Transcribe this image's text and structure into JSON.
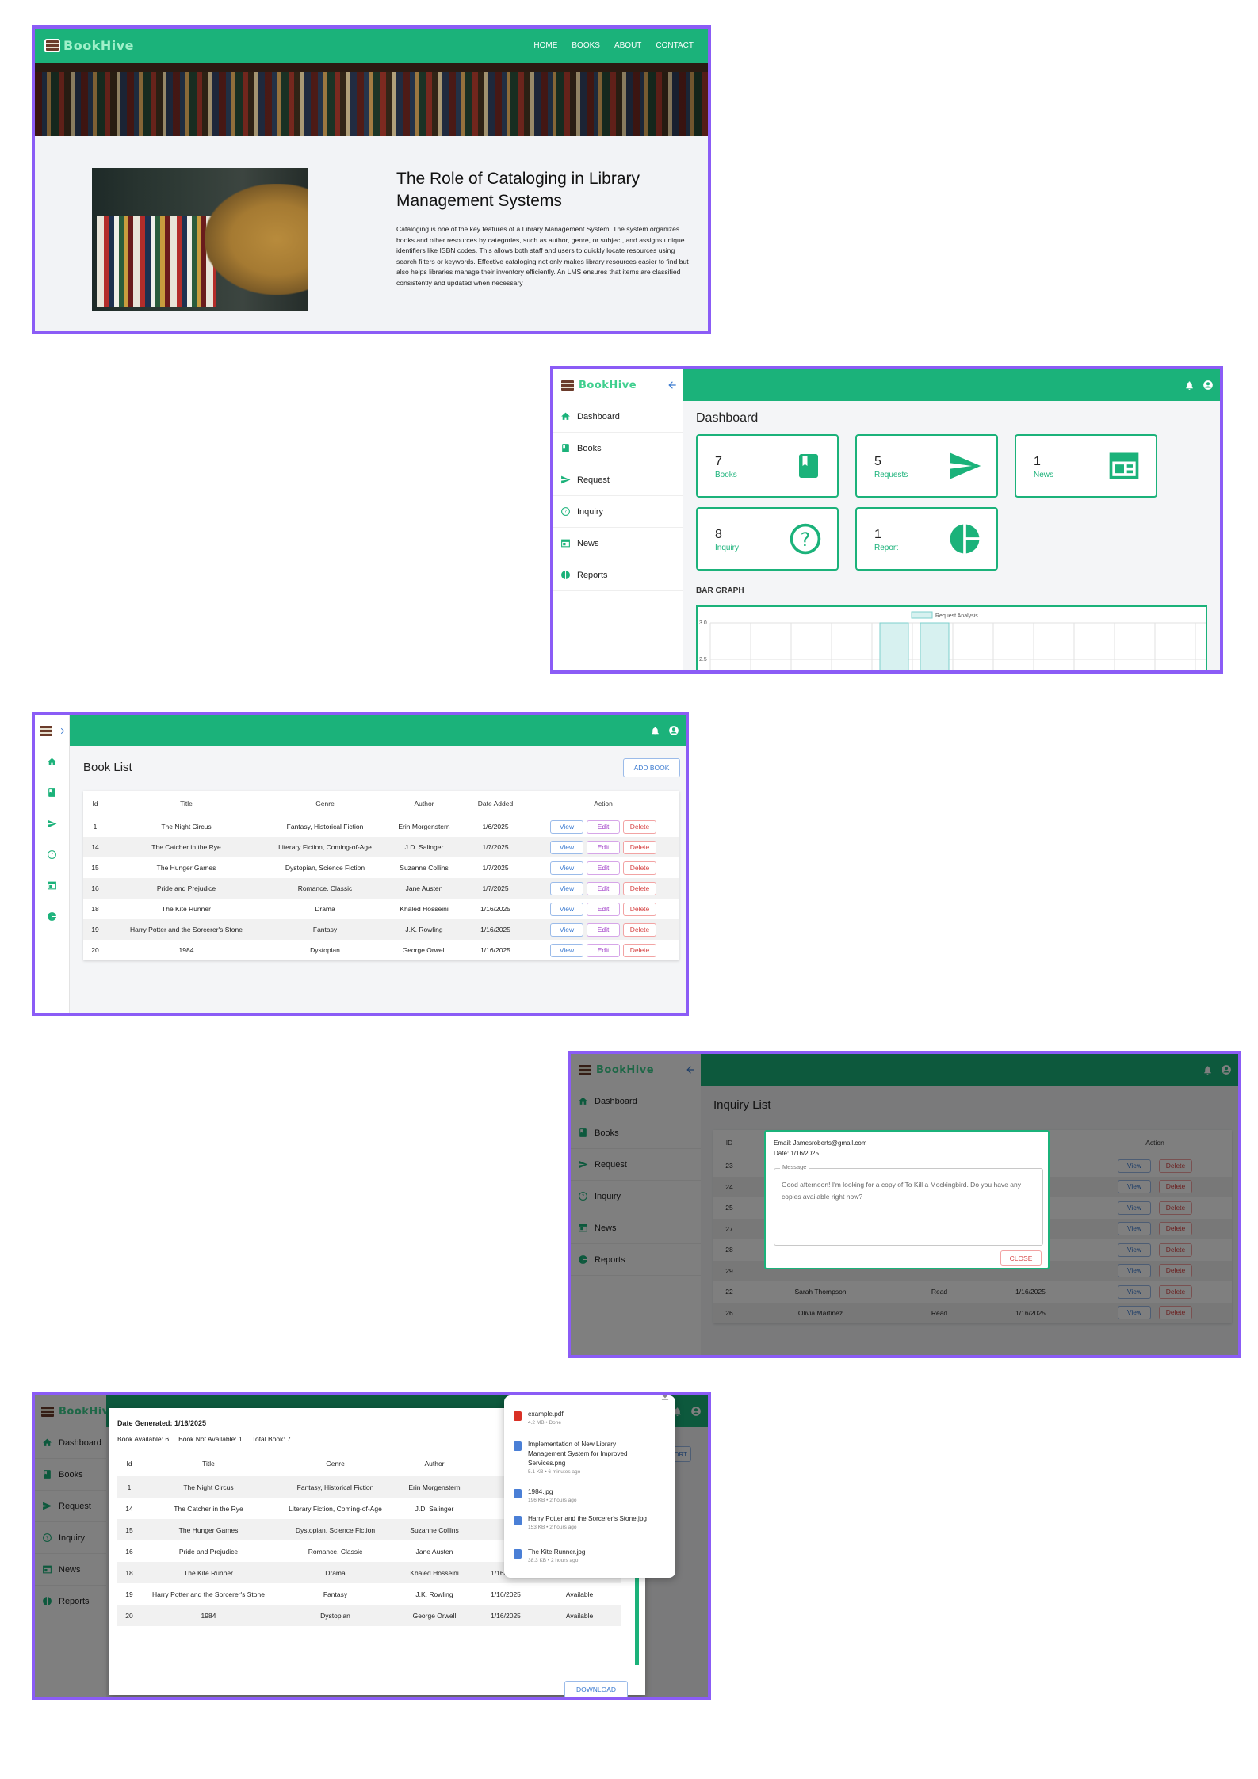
{
  "brand": {
    "name": "BookHive",
    "accent": "#1bb27a",
    "panel_border": "#8b5cf6"
  },
  "landing": {
    "nav": [
      "HOME",
      "BOOKS",
      "ABOUT",
      "CONTACT"
    ],
    "article_title": "The Role of Cataloging in Library Management Systems",
    "article_body": "Cataloging is one of the key features of a Library Management System. The system organizes books and other resources by categories, such as author, genre, or subject, and assigns unique identifiers like ISBN codes. This allows both staff and users to quickly locate resources using search filters or keywords. Effective cataloging not only makes library resources easier to find but also helps libraries manage their inventory efficiently. An LMS ensures that items are classified consistently and updated when necessary"
  },
  "sidebar": {
    "items": [
      {
        "label": "Dashboard",
        "icon": "home-icon"
      },
      {
        "label": "Books",
        "icon": "book-icon"
      },
      {
        "label": "Request",
        "icon": "send-icon"
      },
      {
        "label": "Inquiry",
        "icon": "help-icon"
      },
      {
        "label": "News",
        "icon": "news-icon"
      },
      {
        "label": "Reports",
        "icon": "pie-chart-icon"
      }
    ]
  },
  "dashboard": {
    "title": "Dashboard",
    "cards": [
      {
        "value": "7",
        "label": "Books",
        "icon": "book-icon"
      },
      {
        "value": "5",
        "label": "Requests",
        "icon": "send-icon"
      },
      {
        "value": "1",
        "label": "News",
        "icon": "news-icon"
      },
      {
        "value": "8",
        "label": "Inquiry",
        "icon": "help-icon"
      },
      {
        "value": "1",
        "label": "Report",
        "icon": "pie-chart-icon"
      }
    ],
    "graph_label": "BAR GRAPH",
    "chart_data": {
      "type": "bar",
      "legend": "Request Analysis",
      "yticks": [
        "3.0",
        "2.5"
      ],
      "ylim": [
        2.5,
        3.0
      ]
    }
  },
  "book_list": {
    "title": "Book List",
    "add_button": "ADD BOOK",
    "columns": [
      "Id",
      "Title",
      "Genre",
      "Author",
      "Date Added",
      "Action"
    ],
    "rows": [
      [
        "1",
        "The Night Circus",
        "Fantasy, Historical Fiction",
        "Erin Morgenstern",
        "1/6/2025"
      ],
      [
        "14",
        "The Catcher in the Rye",
        "Literary Fiction, Coming-of-Age",
        "J.D. Salinger",
        "1/7/2025"
      ],
      [
        "15",
        "The Hunger Games",
        "Dystopian, Science Fiction",
        "Suzanne Collins",
        "1/7/2025"
      ],
      [
        "16",
        "Pride and Prejudice",
        "Romance, Classic",
        "Jane Austen",
        "1/7/2025"
      ],
      [
        "18",
        "The Kite Runner",
        "Drama",
        "Khaled Hosseini",
        "1/16/2025"
      ],
      [
        "19",
        "Harry Potter and the Sorcerer's Stone",
        "Fantasy",
        "J.K. Rowling",
        "1/16/2025"
      ],
      [
        "20",
        "1984",
        "Dystopian",
        "George Orwell",
        "1/16/2025"
      ]
    ],
    "actions": [
      "View",
      "Edit",
      "Delete"
    ]
  },
  "inquiry": {
    "title": "Inquiry List",
    "columns": [
      "ID",
      "Action"
    ],
    "rows": [
      {
        "id": "23",
        "name": "",
        "status": "",
        "date": ""
      },
      {
        "id": "24",
        "name": "",
        "status": "",
        "date": ""
      },
      {
        "id": "25",
        "name": "",
        "status": "",
        "date": ""
      },
      {
        "id": "27",
        "name": "",
        "status": "",
        "date": ""
      },
      {
        "id": "28",
        "name": "",
        "status": "",
        "date": ""
      },
      {
        "id": "29",
        "name": "",
        "status": "",
        "date": ""
      },
      {
        "id": "22",
        "name": "Sarah Thompson",
        "status": "Read",
        "date": "1/16/2025"
      },
      {
        "id": "26",
        "name": "Olivia Martinez",
        "status": "Read",
        "date": "1/16/2025"
      }
    ],
    "actions": [
      "View",
      "Delete"
    ],
    "dialog": {
      "email": "Email: Jamesroberts@gmail.com",
      "date": "Date: 1/16/2025",
      "message_label": "Message",
      "message": "Good afternoon! I'm looking for a copy of To Kill a Mockingbird. Do you have any copies available right now?",
      "close": "CLOSE"
    }
  },
  "report": {
    "generated": "Date Generated: 1/16/2025",
    "stats": [
      "Book Available: 6",
      "Book Not Available: 1",
      "Total Book: 7"
    ],
    "columns": [
      "Id",
      "Title",
      "Genre",
      "Author",
      "",
      ""
    ],
    "rows": [
      [
        "1",
        "The Night Circus",
        "Fantasy, Historical Fiction",
        "Erin Morgenstern",
        "",
        ""
      ],
      [
        "14",
        "The Catcher in the Rye",
        "Literary Fiction, Coming-of-Age",
        "J.D. Salinger",
        "",
        ""
      ],
      [
        "15",
        "The Hunger Games",
        "Dystopian, Science Fiction",
        "Suzanne Collins",
        "",
        ""
      ],
      [
        "16",
        "Pride and Prejudice",
        "Romance, Classic",
        "Jane Austen",
        "",
        ""
      ],
      [
        "18",
        "The Kite Runner",
        "Drama",
        "Khaled Hosseini",
        "1/16/2025",
        "Available"
      ],
      [
        "19",
        "Harry Potter and the Sorcerer's Stone",
        "Fantasy",
        "J.K. Rowling",
        "1/16/2025",
        "Available"
      ],
      [
        "20",
        "1984",
        "Dystopian",
        "George Orwell",
        "1/16/2025",
        "Available"
      ]
    ],
    "download": "DOWNLOAD",
    "bg_button_fragment": "PORT",
    "downloads": [
      {
        "name": "example.pdf",
        "meta": "4.2 MB • Done",
        "color": "#d93025"
      },
      {
        "name": "Implementation of New Library Management System for Improved Services.png",
        "meta": "5.1 KB • 6 minutes ago",
        "color": "#4a7fd6"
      },
      {
        "name": "1984.jpg",
        "meta": "196 KB • 2 hours ago",
        "color": "#4a7fd6"
      },
      {
        "name": "Harry Potter and the Sorcerer's Stone.jpg",
        "meta": "153 KB • 2 hours ago",
        "color": "#4a7fd6"
      },
      {
        "name": "The Kite Runner.jpg",
        "meta": "38.3 KB • 2 hours ago",
        "color": "#4a7fd6"
      }
    ]
  }
}
